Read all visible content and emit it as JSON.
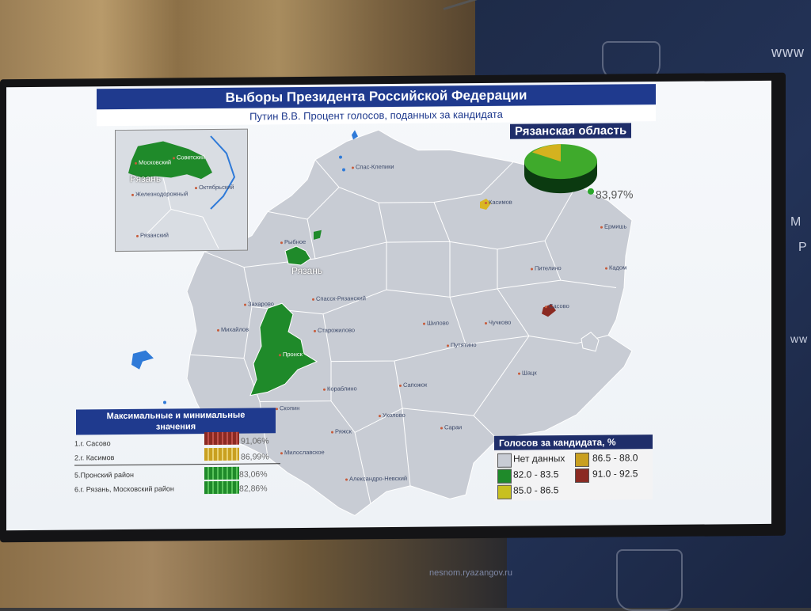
{
  "slide": {
    "title": "Выборы Президента Российской Федерации",
    "subtitle": "Путин В.В. Процент голосов, поданных за кандидата",
    "region_title": "Рязанская область",
    "region_pct": "83,97%"
  },
  "inset": {
    "labels": [
      "Московский",
      "Советский",
      "Рязань",
      "Железнодорожный",
      "Октябрьский",
      "Рязанский"
    ]
  },
  "map": {
    "city_big": "Рязань",
    "districts": [
      "Спас-Клепики",
      "Касимов",
      "Ермишь",
      "Рыбное",
      "Пителино",
      "Кадом",
      "Захарово",
      "Спасск-Рязанский",
      "Михайлов",
      "Старожилово",
      "Шилово",
      "Чучково",
      "Сасово",
      "Пронск",
      "Путятино",
      "Кораблино",
      "Сапожок",
      "Шацк",
      "Скопин",
      "Ряжск",
      "Ухолово",
      "Сараи",
      "Милославское",
      "Александро-Невский"
    ]
  },
  "minmax": {
    "title_line1": "Максимальные и минимальные",
    "title_line2": "значения",
    "rows": [
      {
        "label": "1.г. Сасово",
        "value": "91,06%",
        "color": "#8b2a22"
      },
      {
        "label": "2.г. Касимов",
        "value": "86,99%",
        "color": "#c9a020"
      },
      {
        "label": "5.Пронский район",
        "value": "83,06%",
        "color": "#1f8a2a"
      },
      {
        "label": "6.г. Рязань, Московский район",
        "value": "82,86%",
        "color": "#1f8a2a"
      }
    ]
  },
  "legend": {
    "title": "Голосов за кандидата, %",
    "items": [
      {
        "label": "Нет данных",
        "color": "#c8ccd4"
      },
      {
        "label": "86.5 - 88.0",
        "color": "#c9a020"
      },
      {
        "label": "82.0 - 83.5",
        "color": "#1f8a2a"
      },
      {
        "label": "91.0 - 92.5",
        "color": "#8b2a22"
      },
      {
        "label": "85.0 - 86.5",
        "color": "#c8c020"
      }
    ]
  },
  "room": {
    "www1": "www",
    "www2": "ww",
    "letter_m": "М",
    "letter_r": "Р",
    "url": "nesnom.ryazangov.ru"
  }
}
